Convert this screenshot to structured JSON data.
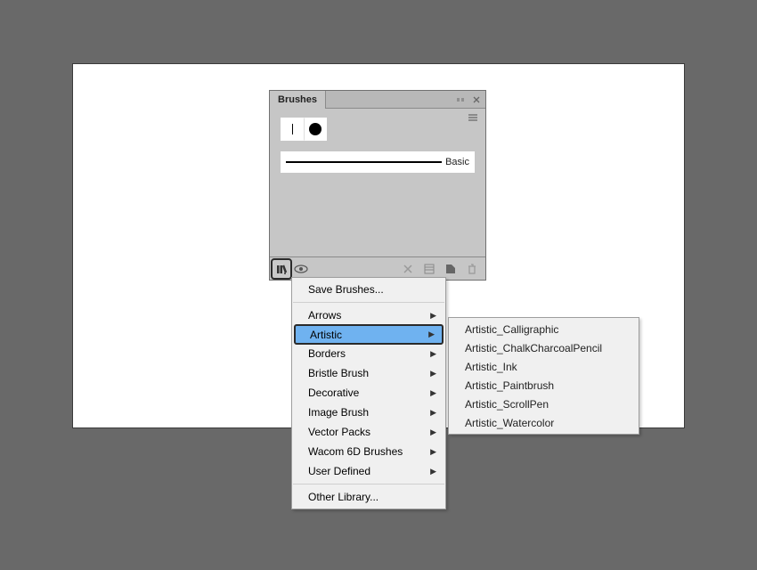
{
  "panel": {
    "tab_label": "Brushes",
    "basic_label": "Basic"
  },
  "menu": {
    "save": "Save Brushes...",
    "other": "Other Library...",
    "cats": [
      "Arrows",
      "Artistic",
      "Borders",
      "Bristle Brush",
      "Decorative",
      "Image Brush",
      "Vector Packs",
      "Wacom 6D Brushes",
      "User Defined"
    ]
  },
  "submenu": [
    "Artistic_Calligraphic",
    "Artistic_ChalkCharcoalPencil",
    "Artistic_Ink",
    "Artistic_Paintbrush",
    "Artistic_ScrollPen",
    "Artistic_Watercolor"
  ]
}
